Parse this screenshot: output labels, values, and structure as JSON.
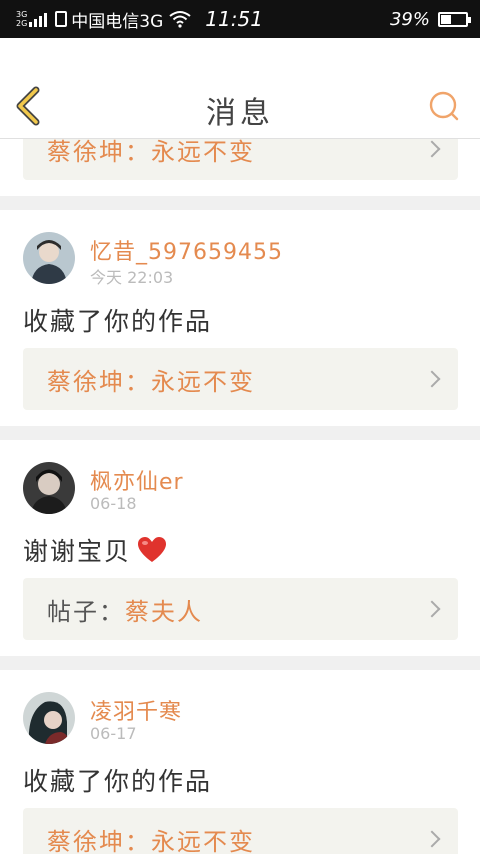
{
  "status_bar": {
    "net_top": "3G",
    "net_bottom": "2G",
    "carrier": "中国电信3G",
    "time": "11:51",
    "battery_pct": "39%",
    "battery_level": 0.39
  },
  "header": {
    "title": "消息",
    "back_icon": "chevron-left-icon",
    "search_icon": "search-icon",
    "accent": "#f2c94c"
  },
  "colors": {
    "accent": "#e48a4f",
    "ref_bg": "#f3f3ee"
  },
  "top_card": {
    "ref_label": "蔡徐坤：",
    "ref_value": "永远不变"
  },
  "messages": [
    {
      "username": "忆昔_597659455",
      "time": "今天 22:03",
      "text": "收藏了你的作品",
      "ref_label": "蔡徐坤：",
      "ref_value": "永远不变",
      "emoji": ""
    },
    {
      "username": "枫亦仙er",
      "time": "06-18",
      "text": "谢谢宝贝",
      "ref_label": "帖子：",
      "ref_value": "蔡夫人",
      "emoji": "heart"
    },
    {
      "username": "凌羽千寒",
      "time": "06-17",
      "text": "收藏了你的作品",
      "ref_label": "蔡徐坤：",
      "ref_value": "永远不变",
      "emoji": ""
    }
  ]
}
